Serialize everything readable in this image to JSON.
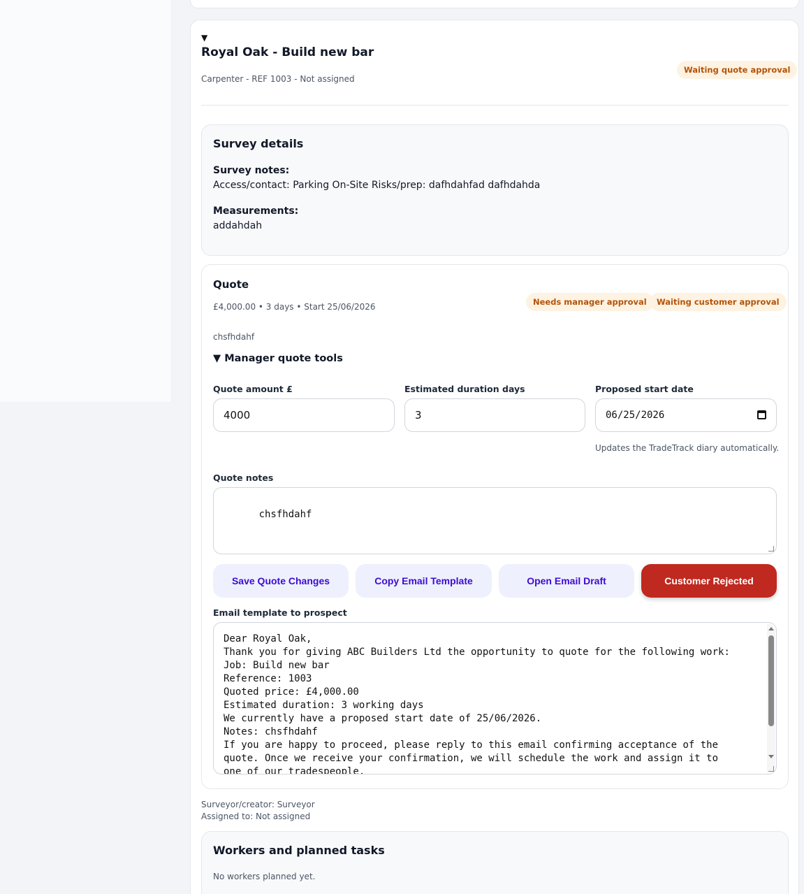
{
  "job": {
    "title": "Royal Oak - Build new bar",
    "subtitle": "Carpenter - REF 1003 - Not assigned",
    "status_badge": "Waiting quote approval"
  },
  "survey": {
    "heading": "Survey details",
    "notes_label": "Survey notes:",
    "notes_value": "Access/contact: Parking On-Site Risks/prep: dafhdahfad dafhdahda",
    "measurements_label": "Measurements:",
    "measurements_value": "addahdah"
  },
  "quote": {
    "heading": "Quote",
    "summary": "£4,000.00 • 3 days • Start 25/06/2026",
    "badge_manager": "Needs manager approval",
    "badge_customer": "Waiting customer approval",
    "note_preview": "chsfhdahf",
    "tools_toggle": "▼ Manager quote tools",
    "amount_label": "Quote amount £",
    "amount_value": "4000",
    "duration_label": "Estimated duration days",
    "duration_value": "3",
    "start_label": "Proposed start date",
    "start_value": "06/25/2026",
    "diary_hint": "Updates the TradeTrack diary automatically.",
    "notes_label": "Quote notes",
    "notes_value": "chsfhdahf",
    "buttons": {
      "save": "Save Quote Changes",
      "copy": "Copy Email Template",
      "open": "Open Email Draft",
      "reject": "Customer Rejected"
    },
    "email_label": "Email template to prospect",
    "email_lines": [
      "Dear Royal Oak,",
      "Thank you for giving ABC Builders Ltd the opportunity to quote for the following work:",
      "Job: Build new bar",
      "Reference: 1003",
      "Quoted price: £4,000.00",
      "Estimated duration: 3 working days",
      "We currently have a proposed start date of 25/06/2026.",
      "Notes: chsfhdahf",
      "If you are happy to proceed, please reply to this email confirming acceptance of the",
      "quote. Once we receive your confirmation, we will schedule the work and assign it to",
      "one of our tradespeople."
    ]
  },
  "meta": {
    "surveyor": "Surveyor/creator: Surveyor",
    "assigned": "Assigned to: Not assigned"
  },
  "workers": {
    "heading": "Workers and planned tasks",
    "empty": "No workers planned yet."
  }
}
